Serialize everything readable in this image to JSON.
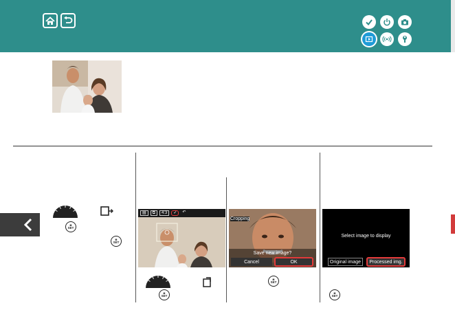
{
  "header": {
    "bg": "#2e8e8b",
    "nav": [
      {
        "name": "home-icon"
      },
      {
        "name": "back-arrow-icon"
      }
    ],
    "section_icons": [
      {
        "name": "check-icon",
        "active": false
      },
      {
        "name": "power-icon",
        "active": false
      },
      {
        "name": "camera-icon",
        "active": false
      },
      {
        "name": "playback-icon",
        "active": true
      },
      {
        "name": "wireless-icon",
        "active": false
      },
      {
        "name": "wrench-icon",
        "active": false
      }
    ]
  },
  "steps": {
    "step2_screen": {
      "toolbar_aspect": "4:3"
    },
    "step3_screen": {
      "label": "Cropping",
      "prompt": "Save new image?",
      "cancel": "Cancel",
      "ok": "OK"
    },
    "step4_screen": {
      "message": "Select image to display",
      "original": "Original image",
      "processed": "Processed img."
    }
  },
  "colors": {
    "highlight": "#e43a3a",
    "active_icon": "#1e9bd7"
  }
}
